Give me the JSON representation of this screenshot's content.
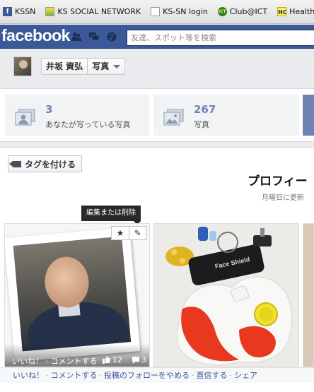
{
  "bookmarks": [
    {
      "label": "KSSN",
      "icon": "facebook-icon"
    },
    {
      "label": "KS SOCIAL NETWORK",
      "icon": "ks-icon"
    },
    {
      "label": "KS-SN login",
      "icon": "page-icon"
    },
    {
      "label": "Club@ICT",
      "icon": "ict-icon"
    },
    {
      "label": "Health C",
      "icon": "hc-icon"
    }
  ],
  "header": {
    "logo": "facebook",
    "search_placeholder": "友達、スポット等を検索"
  },
  "profile": {
    "name": "井坂 資弘",
    "section": "写真"
  },
  "stats": [
    {
      "count": "3",
      "label": "あなたが写っている写真"
    },
    {
      "count": "267",
      "label": "写真"
    }
  ],
  "album": {
    "tag_button": "タグを付ける",
    "title": "プロフィー",
    "subtitle": "月曜日に更新"
  },
  "tooltip": "編集または削除",
  "photo1": {
    "like_comment": "いいね！ · コメントする",
    "likes": "12",
    "comments": "3"
  },
  "actions": {
    "like": "いいね！",
    "comment": "コメントする",
    "unfollow": "投稿のフォローをやめる",
    "message": "直信する",
    "share": "シェア"
  },
  "colors": {
    "brand": "#3b5998",
    "stat_number": "#6d84b4"
  }
}
